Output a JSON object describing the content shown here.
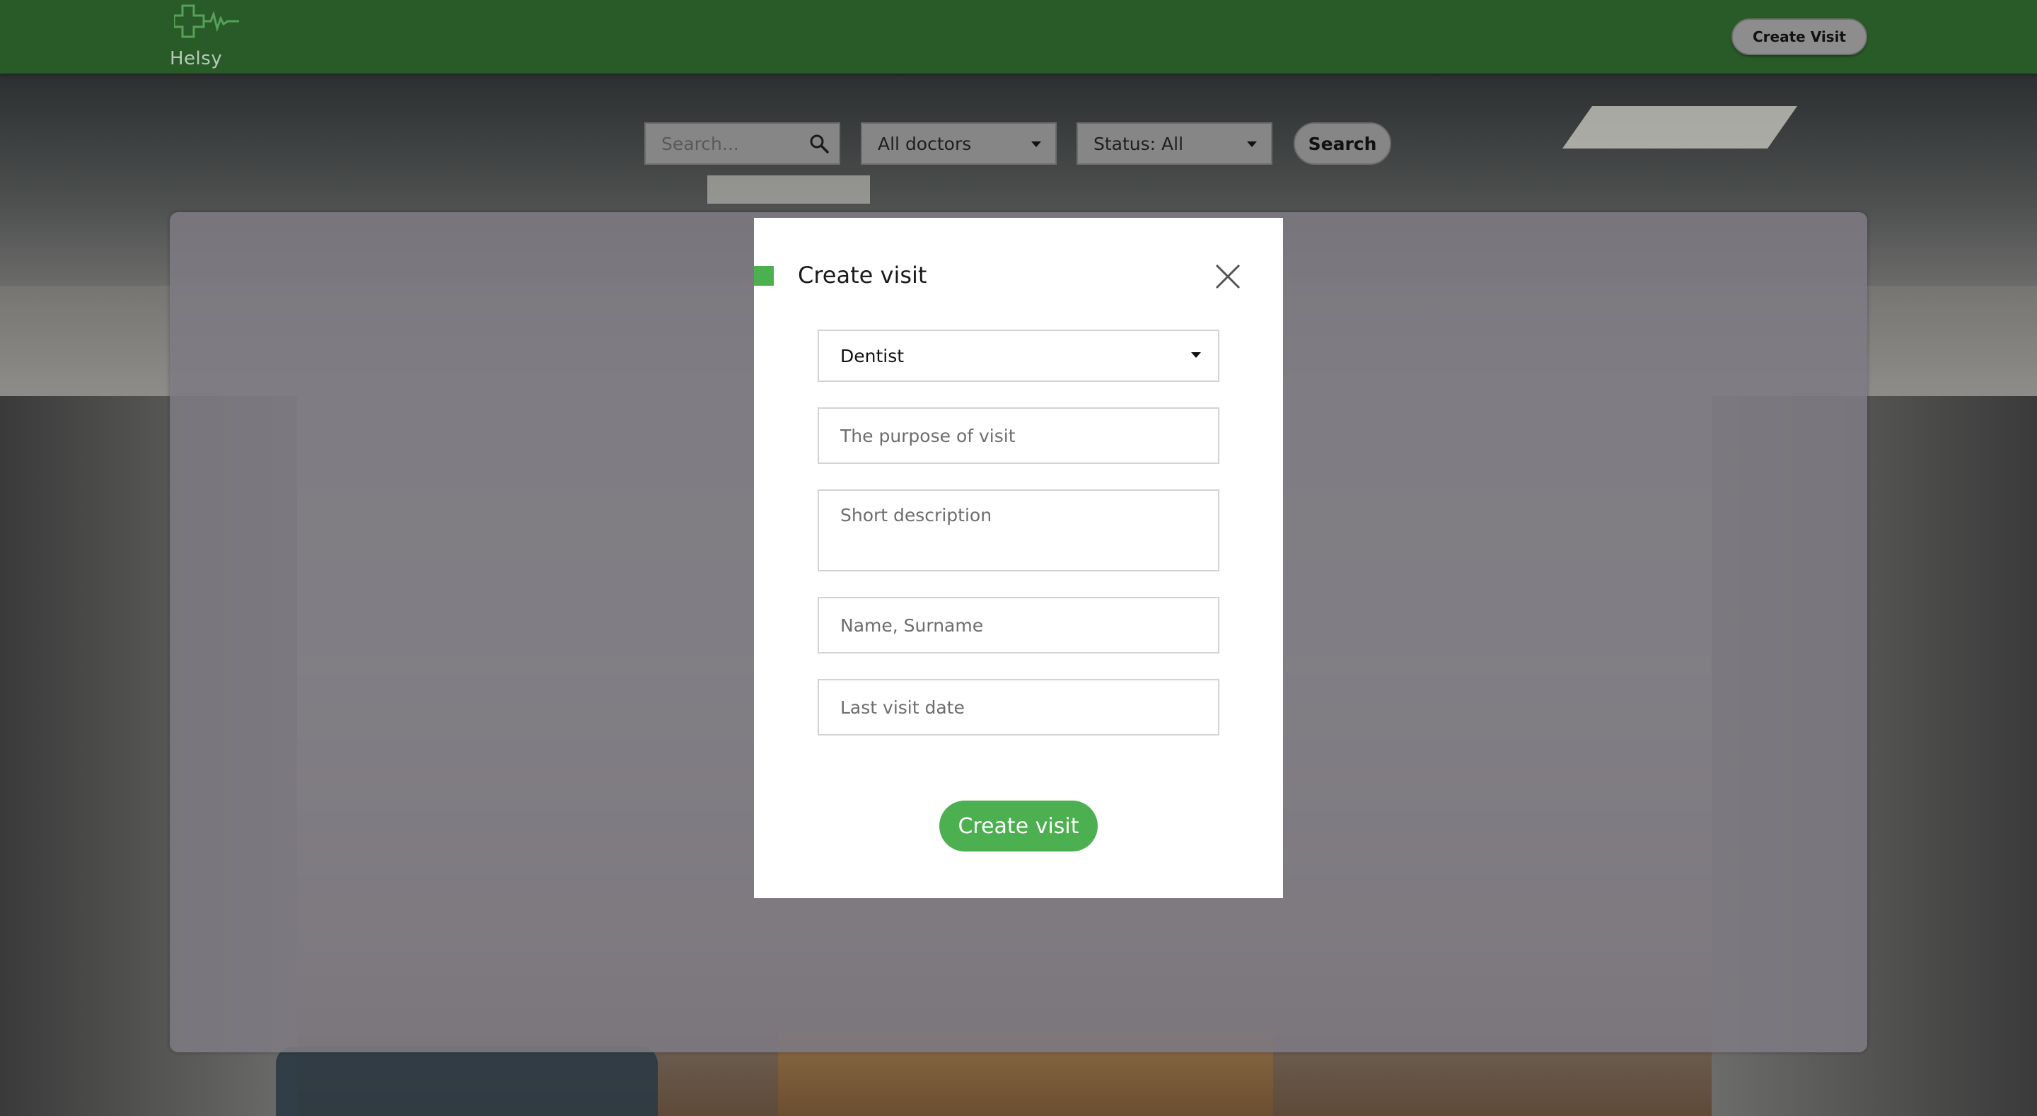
{
  "header": {
    "logo_text": "Helsy",
    "create_visit_label": "Create Visit",
    "bar_color": "#285b28"
  },
  "filters": {
    "search_placeholder": "Search...",
    "doctor_selected": "All doctors",
    "status_selected": "Status: All",
    "search_button_label": "Search"
  },
  "modal": {
    "title": "Create visit",
    "accent_color": "#4caf50",
    "doctor_selected": "Dentist",
    "purpose_placeholder": "The purpose of visit",
    "description_placeholder": "Short description",
    "name_placeholder": "Name, Surname",
    "last_visit_placeholder": "Last visit date",
    "submit_label": "Create visit"
  }
}
